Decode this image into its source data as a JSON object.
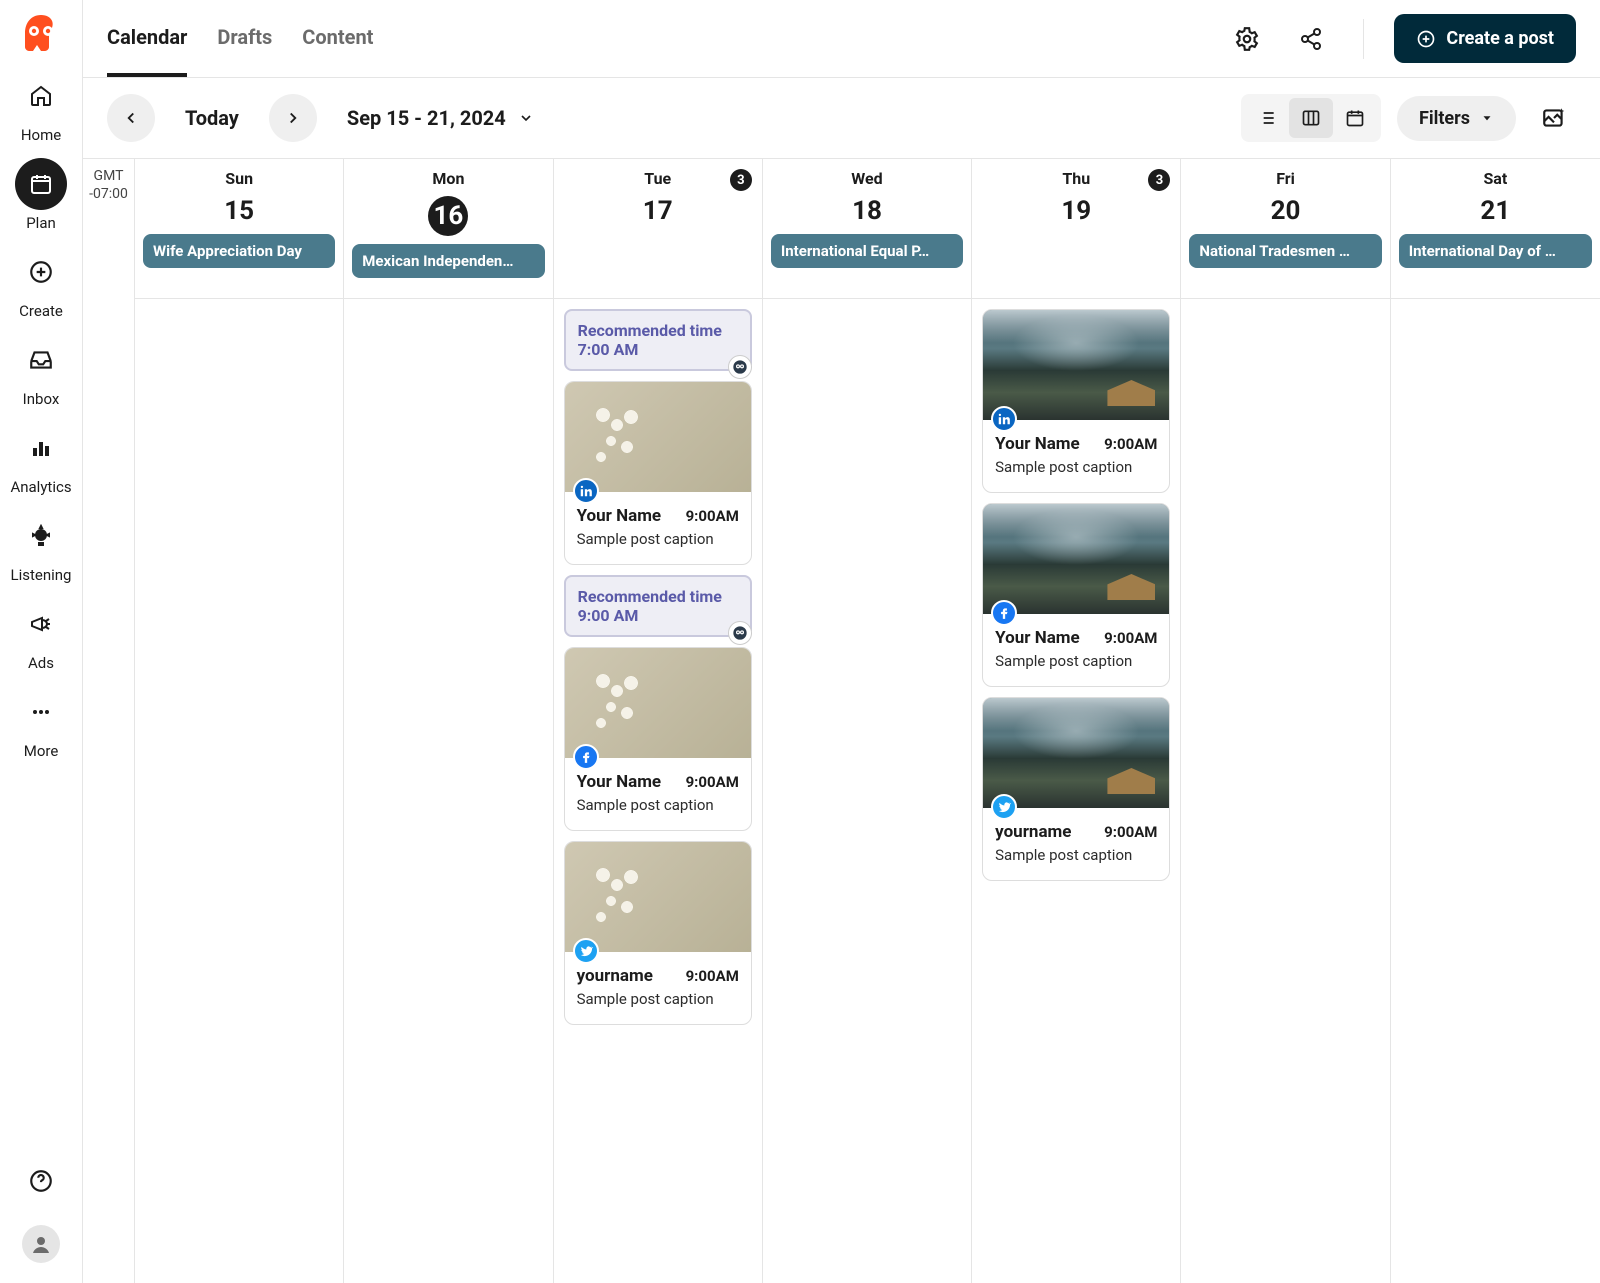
{
  "sidebar": {
    "items": [
      {
        "id": "home",
        "label": "Home"
      },
      {
        "id": "plan",
        "label": "Plan"
      },
      {
        "id": "create",
        "label": "Create"
      },
      {
        "id": "inbox",
        "label": "Inbox"
      },
      {
        "id": "analytics",
        "label": "Analytics"
      },
      {
        "id": "listening",
        "label": "Listening"
      },
      {
        "id": "ads",
        "label": "Ads"
      },
      {
        "id": "more",
        "label": "More"
      }
    ]
  },
  "topbar": {
    "tabs": [
      {
        "id": "calendar",
        "label": "Calendar",
        "active": true
      },
      {
        "id": "drafts",
        "label": "Drafts"
      },
      {
        "id": "content",
        "label": "Content"
      }
    ],
    "create_label": "Create a post"
  },
  "toolbar": {
    "today_label": "Today",
    "date_range": "Sep 15 - 21, 2024",
    "filters_label": "Filters"
  },
  "timezone": {
    "line1": "GMT",
    "line2": "-07:00"
  },
  "days": [
    {
      "name": "Sun",
      "num": "15",
      "today": false,
      "count": null,
      "holiday": "Wife Appreciation Day"
    },
    {
      "name": "Mon",
      "num": "16",
      "today": true,
      "count": null,
      "holiday": "Mexican Independen…"
    },
    {
      "name": "Tue",
      "num": "17",
      "today": false,
      "count": 3,
      "holiday": null
    },
    {
      "name": "Wed",
      "num": "18",
      "today": false,
      "count": null,
      "holiday": "International Equal P…"
    },
    {
      "name": "Thu",
      "num": "19",
      "today": false,
      "count": 3,
      "holiday": null
    },
    {
      "name": "Fri",
      "num": "20",
      "today": false,
      "count": null,
      "holiday": "National Tradesmen …"
    },
    {
      "name": "Sat",
      "num": "21",
      "today": false,
      "count": null,
      "holiday": "International Day of …"
    }
  ],
  "recommended": {
    "title": "Recommended time",
    "slots": [
      {
        "time": "7:00 AM"
      },
      {
        "time": "9:00 AM"
      }
    ]
  },
  "posts": {
    "tue": [
      {
        "author": "Your Name",
        "time": "9:00AM",
        "caption": "Sample post caption",
        "network": "linkedin",
        "img": "flowers"
      },
      {
        "author": "Your Name",
        "time": "9:00AM",
        "caption": "Sample post caption",
        "network": "facebook",
        "img": "flowers"
      },
      {
        "author": "yourname",
        "time": "9:00AM",
        "caption": "Sample post caption",
        "network": "twitter",
        "img": "flowers"
      }
    ],
    "thu": [
      {
        "author": "Your Name",
        "time": "9:00AM",
        "caption": "Sample post caption",
        "network": "linkedin",
        "img": "mtn"
      },
      {
        "author": "Your Name",
        "time": "9:00AM",
        "caption": "Sample post caption",
        "network": "facebook",
        "img": "mtn"
      },
      {
        "author": "yourname",
        "time": "9:00AM",
        "caption": "Sample post caption",
        "network": "twitter",
        "img": "mtn"
      }
    ]
  },
  "colors": {
    "brand": "#ff4f1f",
    "holiday_bg": "#4a7a8c",
    "rec_border": "#c9c9dd",
    "rec_text": "#5a5aa8",
    "primary_btn": "#012a3a"
  }
}
